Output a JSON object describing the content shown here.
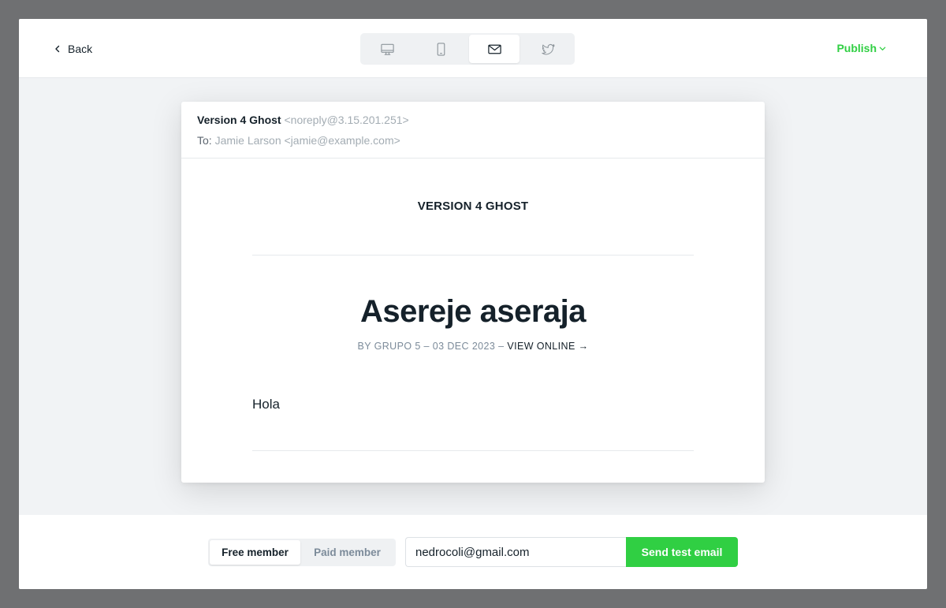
{
  "header": {
    "back_label": "Back",
    "preview_modes": [
      {
        "name": "desktop",
        "icon": "desktop-icon",
        "active": false
      },
      {
        "name": "mobile",
        "icon": "mobile-icon",
        "active": false
      },
      {
        "name": "email",
        "icon": "mail-icon",
        "active": true
      },
      {
        "name": "social",
        "icon": "twitter-icon",
        "active": false
      }
    ],
    "publish_label": "Publish"
  },
  "email": {
    "from_name": "Version 4 Ghost",
    "from_address": "<noreply@3.15.201.251>",
    "to_label": "To:",
    "to_address": "Jamie Larson <jamie@example.com>",
    "site_title": "VERSION 4 GHOST",
    "post_title": "Asereje aseraja",
    "byline": "BY GRUPO 5 – 03 DEC 2023 – ",
    "view_online": "VIEW ONLINE →",
    "body": "Hola"
  },
  "footer": {
    "free_member_label": "Free member",
    "paid_member_label": "Paid member",
    "test_email_value": "nedrocoli@gmail.com",
    "send_label": "Send test email"
  },
  "colors": {
    "accent_green": "#30cf43",
    "overlay": "#6f7072",
    "canvas": "#f1f3f5"
  }
}
